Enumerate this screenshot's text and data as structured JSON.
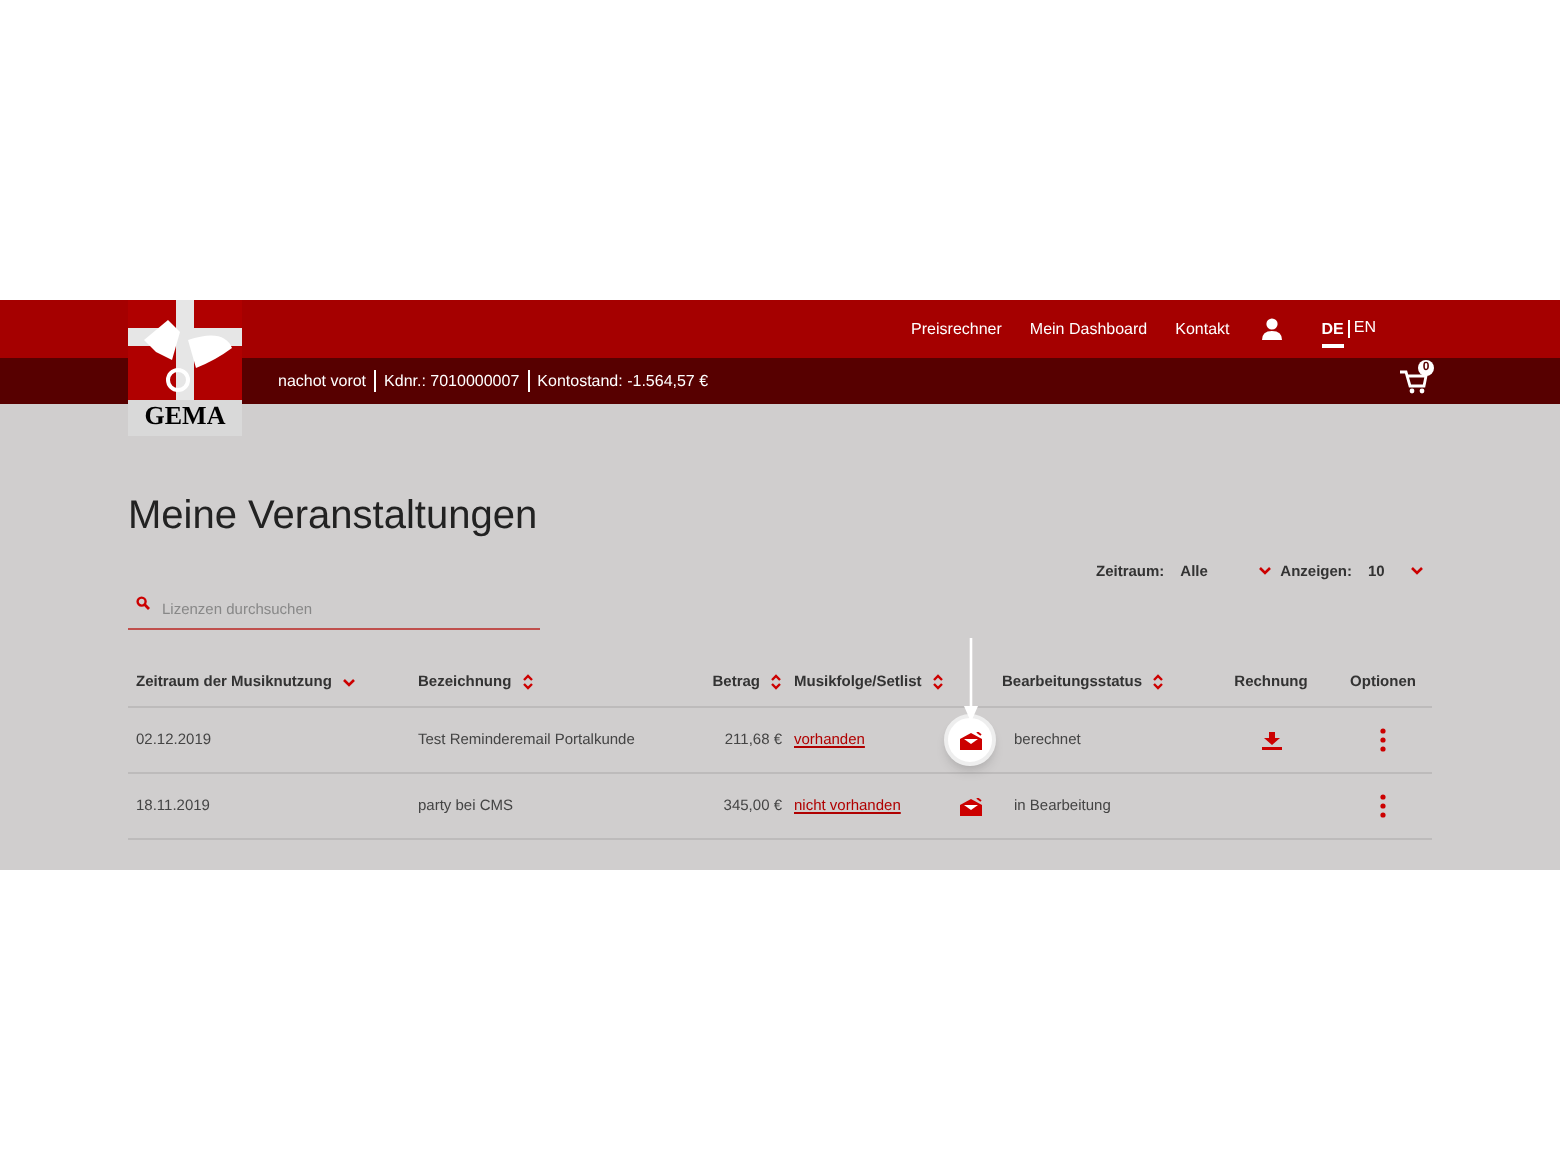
{
  "logo": {
    "text": "GEMA"
  },
  "top_nav": [
    {
      "label": "Preisrechner"
    },
    {
      "label": "Mein Dashboard"
    },
    {
      "label": "Kontakt"
    }
  ],
  "languages": [
    {
      "label": "DE",
      "selected": true
    },
    {
      "label": "EN",
      "selected": false
    }
  ],
  "account_bar": [
    "nachot vorot",
    "Kdnr.:  7010000007",
    "Kontostand:  -1.564,57 €"
  ],
  "cart": {
    "count": "0"
  },
  "heading": "Meine Veranstaltungen",
  "search": {
    "placeholder": "Lizenzen durchsuchen"
  },
  "filters": [
    {
      "label": "Zeitraum:",
      "value": "Alle"
    },
    {
      "label": "Anzeigen:",
      "value": "10"
    }
  ],
  "table": {
    "columns": [
      {
        "label": "Zeitraum der Musiknutzung",
        "sortable": true,
        "sorted": true
      },
      {
        "label": "Bezeichnung",
        "sortable": true,
        "sorted": false
      },
      {
        "label": "Betrag",
        "sortable": true,
        "sorted": false
      },
      {
        "label": "Musikfolge/Setlist",
        "sortable": true,
        "sorted": false
      },
      {
        "label": "Bearbeitungsstatus",
        "sortable": true,
        "sorted": false
      },
      {
        "label": "Rechnung",
        "sortable": false
      },
      {
        "label": "Optionen",
        "sortable": false
      }
    ],
    "rows": [
      {
        "date": "02.12.2019",
        "name": "Test Reminderemail Portalkunde",
        "amount": "211,68 €",
        "setlist": "vorhanden",
        "highlighted": true,
        "status": "berechnet",
        "invoice": true
      },
      {
        "date": "18.11.2019",
        "name": "party bei CMS",
        "amount": "345,00 €",
        "setlist": "nicht vorhanden",
        "highlighted": false,
        "status": "in Bearbeitung",
        "invoice": false
      }
    ]
  }
}
